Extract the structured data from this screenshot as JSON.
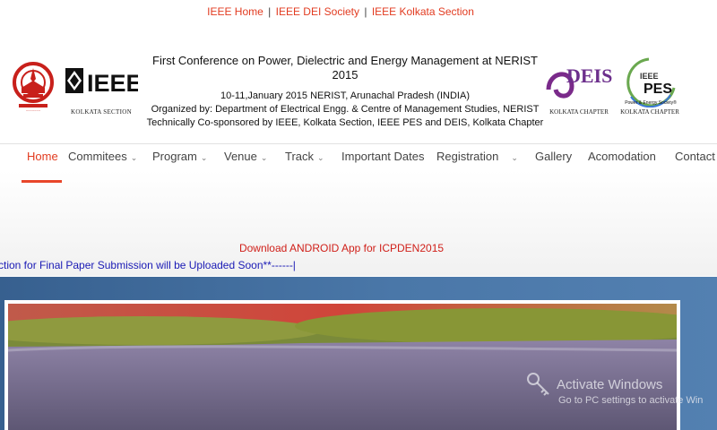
{
  "top_links": [
    "IEEE Home",
    "IEEE DEI Society",
    "IEEE Kolkata Section"
  ],
  "top_links_separator": "|",
  "logos": {
    "left_seal": "institute-seal-icon",
    "ieee": {
      "text": "IEEE",
      "caption": "KOLKATA SECTION"
    },
    "deis": {
      "text": "DEIS",
      "caption": "KOLKATA CHAPTER"
    },
    "pes": {
      "text_top": "IEEE",
      "text_main": "PES",
      "tagline": "Power & Energy Society®",
      "caption": "KOLKATA CHAPTER"
    }
  },
  "header": {
    "title": "First Conference on Power, Dielectric and Energy Management at NERIST 2015",
    "date_line": "10-11,January 2015 NERIST, Arunachal Pradesh (INDIA)",
    "organized_line": "Organized by: Department of Electrical Engg. & Centre of Management Studies, NERIST",
    "sponsor_line": "Technically Co-sponsored by IEEE, Kolkata Section, IEEE PES and DEIS, Kolkata Chapter"
  },
  "nav": {
    "items": [
      {
        "label": "Home",
        "dropdown": false,
        "active": true
      },
      {
        "label": "Commitees",
        "dropdown": true
      },
      {
        "label": "Program",
        "dropdown": true
      },
      {
        "label": "Venue",
        "dropdown": true
      },
      {
        "label": "Track",
        "dropdown": true
      },
      {
        "label": "Important Dates",
        "dropdown": false
      },
      {
        "label": "Registration",
        "dropdown": true
      },
      {
        "label": "Gallery",
        "dropdown": false
      },
      {
        "label": "Acomodation",
        "dropdown": false
      },
      {
        "label": "Contact",
        "dropdown": false
      }
    ]
  },
  "android_link": "Download ANDROID App for ICPDEN2015",
  "marquee_text": "ction for Final Paper Submission will be Uploaded Soon**------|",
  "watermark": {
    "line1": "Activate Windows",
    "line2": "Go to PC settings to activate Win"
  },
  "colors": {
    "accent": "#e23b20",
    "marquee": "#1a1ab5",
    "hero_bg": "#4a77a8"
  }
}
